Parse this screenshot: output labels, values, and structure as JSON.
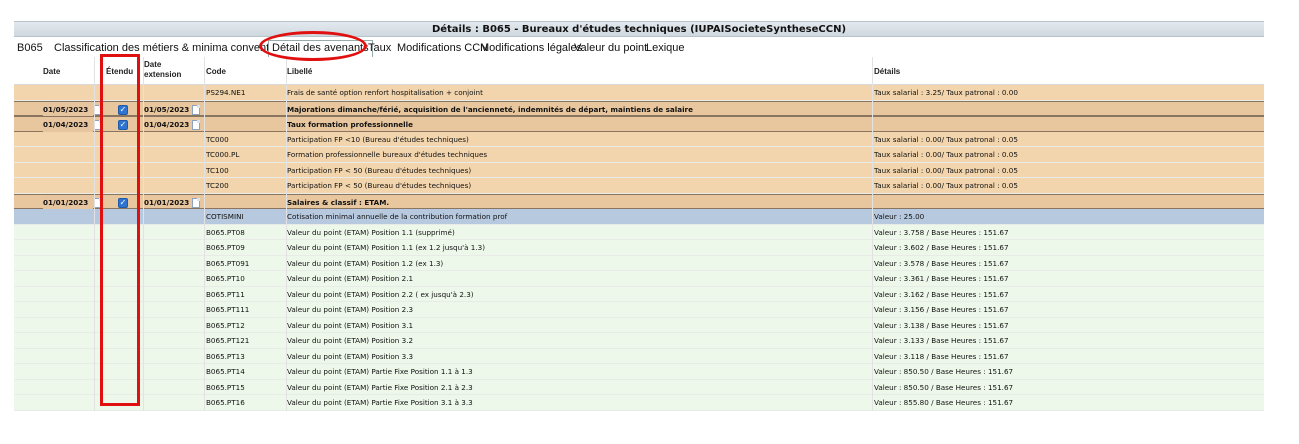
{
  "window": {
    "title": "Détails : B065 - Bureaux d'études techniques (IUPAISocieteSyntheseCCN)"
  },
  "tabs": [
    {
      "label": "B065",
      "active": false
    },
    {
      "label": "Classification des métiers & minima conventionnels",
      "active": false
    },
    {
      "label": "Détail des avenants",
      "active": true
    },
    {
      "label": "Taux",
      "active": false
    },
    {
      "label": "Modifications CCN",
      "active": false
    },
    {
      "label": "Modifications légales",
      "active": false
    },
    {
      "label": "Valeur du point",
      "active": false
    },
    {
      "label": "Lexique",
      "active": false
    }
  ],
  "grid": {
    "columns": {
      "date": "Date",
      "etendu": "Étendu",
      "date_extension_1": "Date",
      "date_extension_2": "extension",
      "code": "Code",
      "libelle": "Libellé",
      "details": "Détails"
    },
    "rows": [
      {
        "type": "av",
        "date": "",
        "checked": false,
        "ext": "",
        "code": "PS294.NE1",
        "libelle": "Frais de santé option renfort hospitalisation + conjoint",
        "details": "Taux salarial : 3.25/ Taux patronal : 0.00"
      },
      {
        "type": "avmain",
        "date": "01/05/2023",
        "checked": true,
        "ext": "01/05/2023",
        "code": "",
        "libelle": "Majorations dimanche/férié, acquisition de l'ancienneté, indemnités de départ, maintiens de salaire",
        "details": ""
      },
      {
        "type": "avmain",
        "date": "01/04/2023",
        "checked": true,
        "ext": "01/04/2023",
        "code": "",
        "libelle": "Taux formation professionnelle",
        "details": ""
      },
      {
        "type": "av",
        "date": "",
        "checked": false,
        "ext": "",
        "code": "TC000",
        "libelle": "Participation FP <10 (Bureau d'études techniques)",
        "details": "Taux salarial : 0.00/ Taux patronal : 0.05"
      },
      {
        "type": "av",
        "date": "",
        "checked": false,
        "ext": "",
        "code": "TC000.PL",
        "libelle": "Formation professionnelle bureaux d'études techniques",
        "details": "Taux salarial : 0.00/ Taux patronal : 0.05"
      },
      {
        "type": "av",
        "date": "",
        "checked": false,
        "ext": "",
        "code": "TC100",
        "libelle": "Participation FP < 50 (Bureau d'études techniques)",
        "details": "Taux salarial : 0.00/ Taux patronal : 0.05"
      },
      {
        "type": "av",
        "date": "",
        "checked": false,
        "ext": "",
        "code": "TC200",
        "libelle": "Participation FP < 50 (Bureau d'études techniques)",
        "details": "Taux salarial : 0.00/ Taux patronal : 0.05"
      },
      {
        "type": "avmain",
        "date": "01/01/2023",
        "checked": true,
        "ext": "01/01/2023",
        "code": "",
        "libelle": "Salaires & classif : ETAM.",
        "details": ""
      },
      {
        "type": "blue",
        "date": "",
        "checked": false,
        "ext": "",
        "code": "COTISMINI",
        "libelle": "Cotisation minimal annuelle de la contribution formation prof",
        "details": "Valeur : 25.00"
      },
      {
        "type": "green",
        "date": "",
        "checked": false,
        "ext": "",
        "code": "B065.PT08",
        "libelle": "Valeur du point (ETAM) Position 1.1 (supprimé)",
        "details": "Valeur : 3.758 / Base Heures : 151.67"
      },
      {
        "type": "green",
        "date": "",
        "checked": false,
        "ext": "",
        "code": "B065.PT09",
        "libelle": "Valeur du point (ETAM) Position 1.1 (ex 1.2 jusqu'à 1.3)",
        "details": "Valeur : 3.602 / Base Heures : 151.67"
      },
      {
        "type": "green",
        "date": "",
        "checked": false,
        "ext": "",
        "code": "B065.PT091",
        "libelle": "Valeur du point (ETAM) Position 1.2 (ex 1.3)",
        "details": "Valeur : 3.578 / Base Heures : 151.67"
      },
      {
        "type": "green",
        "date": "",
        "checked": false,
        "ext": "",
        "code": "B065.PT10",
        "libelle": "Valeur du point (ETAM) Position 2.1",
        "details": "Valeur : 3.361 / Base Heures : 151.67"
      },
      {
        "type": "green",
        "date": "",
        "checked": false,
        "ext": "",
        "code": "B065.PT11",
        "libelle": "Valeur du point (ETAM) Position 2.2 ( ex jusqu'à 2.3)",
        "details": "Valeur : 3.162 / Base Heures : 151.67"
      },
      {
        "type": "green",
        "date": "",
        "checked": false,
        "ext": "",
        "code": "B065.PT111",
        "libelle": "Valeur du point (ETAM) Position 2.3",
        "details": "Valeur : 3.156 / Base Heures : 151.67"
      },
      {
        "type": "green",
        "date": "",
        "checked": false,
        "ext": "",
        "code": "B065.PT12",
        "libelle": "Valeur du point (ETAM) Position 3.1",
        "details": "Valeur : 3.138 / Base Heures : 151.67"
      },
      {
        "type": "green",
        "date": "",
        "checked": false,
        "ext": "",
        "code": "B065.PT121",
        "libelle": "Valeur du point (ETAM) Position 3.2",
        "details": "Valeur : 3.133 / Base Heures : 151.67"
      },
      {
        "type": "green",
        "date": "",
        "checked": false,
        "ext": "",
        "code": "B065.PT13",
        "libelle": "Valeur du point (ETAM) Position 3.3",
        "details": "Valeur : 3.118 / Base Heures : 151.67"
      },
      {
        "type": "green",
        "date": "",
        "checked": false,
        "ext": "",
        "code": "B065.PT14",
        "libelle": "Valeur du point (ETAM) Partie Fixe Position 1.1 à 1.3",
        "details": "Valeur : 850.50 / Base Heures : 151.67"
      },
      {
        "type": "green",
        "date": "",
        "checked": false,
        "ext": "",
        "code": "B065.PT15",
        "libelle": "Valeur du point (ETAM) Partie Fixe Position 2.1 à 2.3",
        "details": "Valeur : 850.50 / Base Heures : 151.67"
      },
      {
        "type": "green",
        "date": "",
        "checked": false,
        "ext": "",
        "code": "B065.PT16",
        "libelle": "Valeur du point (ETAM) Partie Fixe Position 3.1 à 3.3",
        "details": "Valeur : 855.80 / Base Heures : 151.67"
      }
    ]
  },
  "colors": {
    "annotation": "#e01010",
    "avenant_row": "#f2d5ad",
    "avenant_header_row": "#e8c79f",
    "selected_row": "#b7c9df",
    "value_row": "#eef8ea",
    "checkbox": "#2f74d0"
  }
}
